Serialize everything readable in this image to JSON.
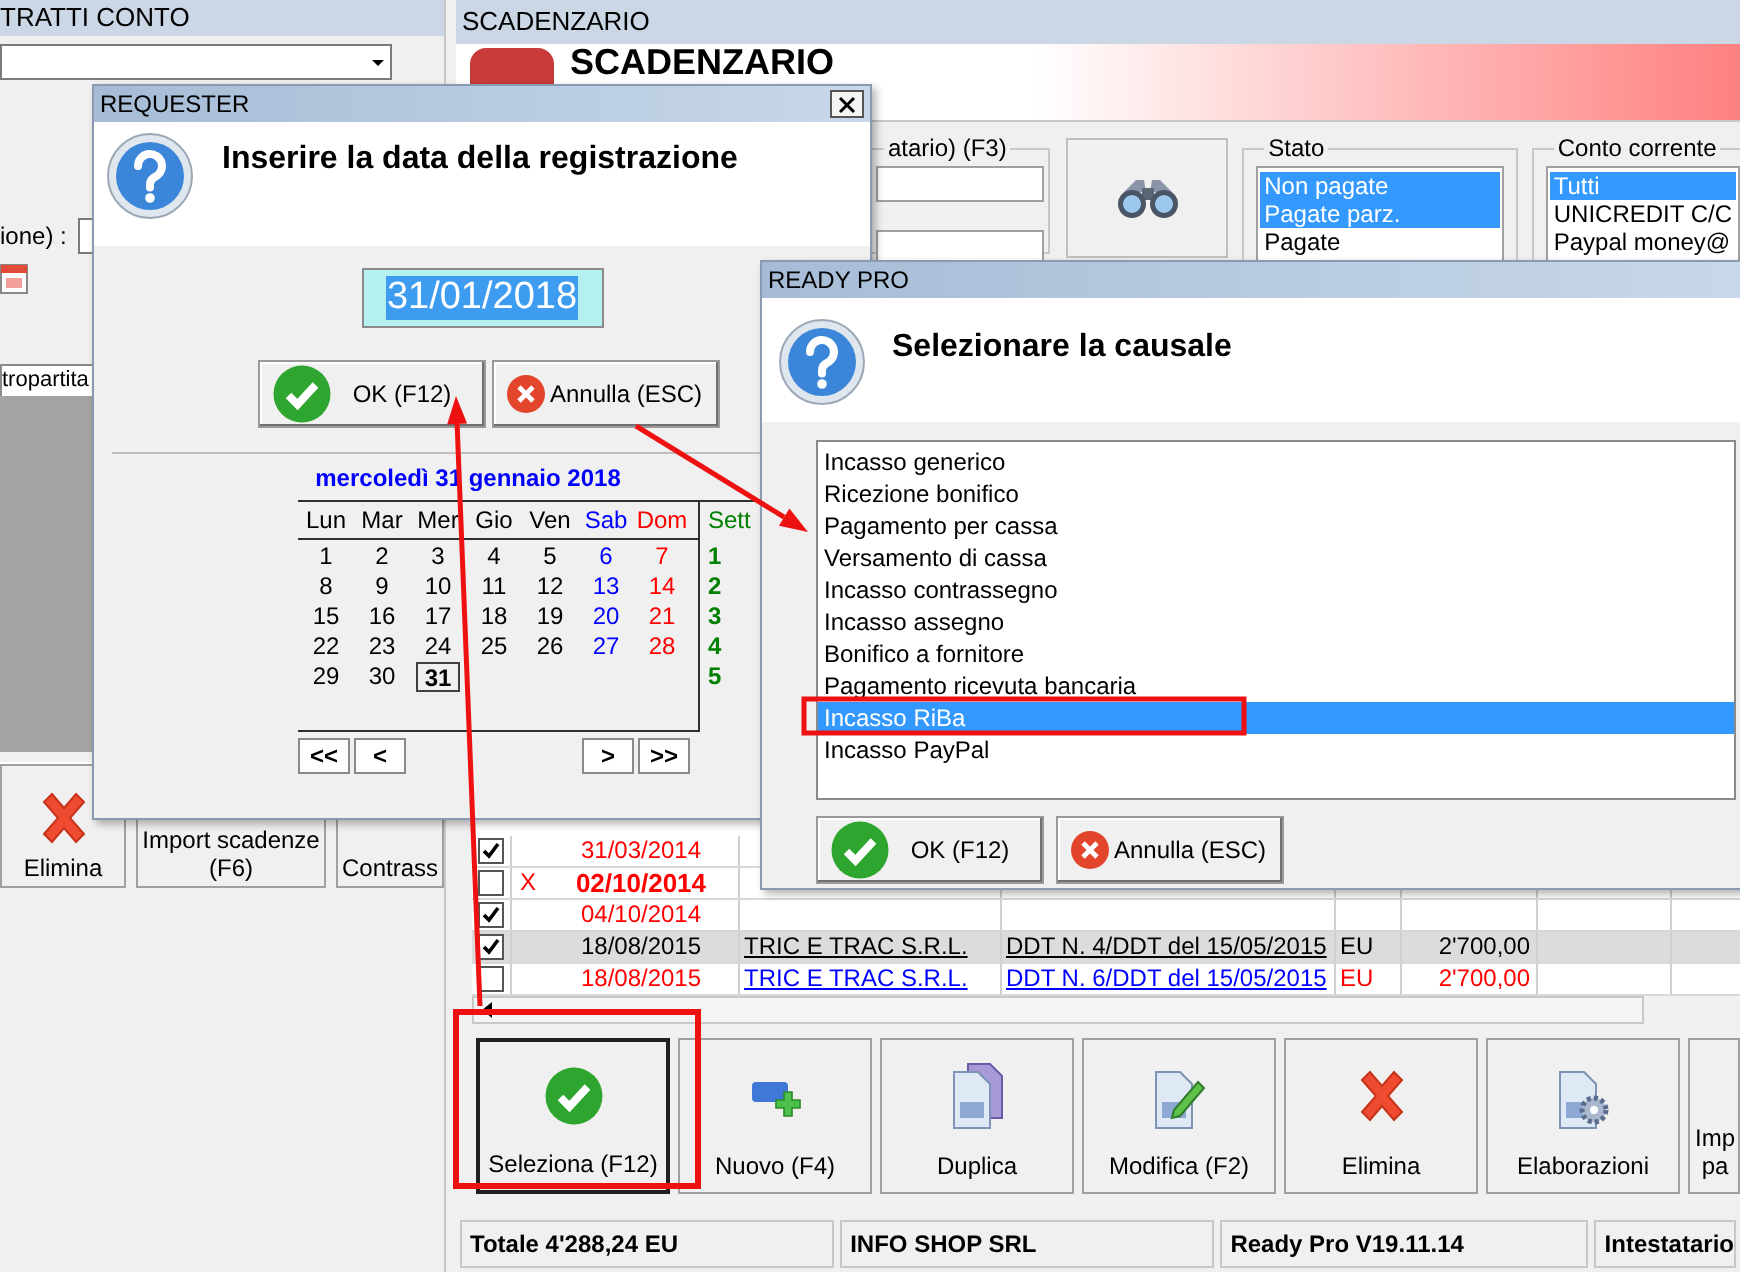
{
  "left_panel": {
    "title": "TRATTI CONTO",
    "field_label": "ione) :",
    "tab_label": "tropartita",
    "buttons": [
      {
        "label": "Elimina"
      },
      {
        "label": "Import scadenze (F6)"
      },
      {
        "label": "Contrass"
      }
    ]
  },
  "scadenzario": {
    "title": "SCADENZARIO",
    "heading": "SCADENZARIO",
    "search_legend": "atario) (F3)",
    "stato": {
      "legend": "Stato",
      "items": [
        {
          "label": "Non pagate",
          "selected": true
        },
        {
          "label": "Pagate parz.",
          "selected": true
        },
        {
          "label": "Pagate",
          "selected": false
        }
      ]
    },
    "conto_corrente": {
      "legend": "Conto corrente",
      "items": [
        {
          "label": "Tutti",
          "selected": true
        },
        {
          "label": "UNICREDIT C/C",
          "selected": false
        },
        {
          "label": "Paypal money@",
          "selected": false
        }
      ]
    },
    "table": {
      "rows": [
        {
          "checked": true,
          "selected": false,
          "overdue": true,
          "bold": false,
          "date": "31/03/2014"
        },
        {
          "checked": false,
          "selected": false,
          "overdue": true,
          "bold": true,
          "flag": "X",
          "date": "02/10/2014"
        },
        {
          "checked": true,
          "selected": false,
          "overdue": true,
          "bold": false,
          "date": "04/10/2014"
        },
        {
          "checked": true,
          "selected": true,
          "overdue": false,
          "bold": false,
          "date": "18/08/2015",
          "customer": "TRIC E TRAC S.R.L.",
          "document": "DDT N. 4/DDT del 15/05/2015",
          "currency": "EU",
          "amount": "2'700,00"
        },
        {
          "checked": false,
          "selected": false,
          "overdue": true,
          "bold": false,
          "date": "18/08/2015",
          "customer": "TRIC E TRAC S.R.L.",
          "document": "DDT N. 6/DDT del 15/05/2015",
          "currency": "EU",
          "amount": "2'700,00"
        }
      ]
    },
    "buttons": [
      {
        "label": "Seleziona (F12)",
        "focused": true
      },
      {
        "label": "Nuovo (F4)",
        "focused": false
      },
      {
        "label": "Duplica",
        "focused": false
      },
      {
        "label": "Modifica (F2)",
        "focused": false
      },
      {
        "label": "Elimina",
        "focused": false
      },
      {
        "label": "Elaborazioni",
        "focused": false
      },
      {
        "label": "Imp pa",
        "focused": false
      }
    ],
    "status_bar": [
      "Totale 4'288,24 EU",
      "INFO SHOP SRL",
      "Ready Pro V19.11.14",
      "Intestatario"
    ]
  },
  "requester": {
    "title": "REQUESTER",
    "message": "Inserire la data della registrazione",
    "date_value": "31/01/2018",
    "buttons": [
      {
        "label": "OK (F12)"
      },
      {
        "label": "Annulla (ESC)"
      }
    ],
    "calendar": {
      "caption": "mercoledì 31 gennaio 2018",
      "weekdays": [
        {
          "label": "Lun",
          "kind": "weekday"
        },
        {
          "label": "Mar",
          "kind": "weekday"
        },
        {
          "label": "Mer",
          "kind": "weekday"
        },
        {
          "label": "Gio",
          "kind": "weekday"
        },
        {
          "label": "Ven",
          "kind": "weekday"
        },
        {
          "label": "Sab",
          "kind": "saturday"
        },
        {
          "label": "Dom",
          "kind": "sunday"
        }
      ],
      "week_header": "Sett",
      "weeks": [
        {
          "number": "1",
          "days": [
            {
              "label": "1",
              "selected": false
            },
            {
              "label": "2",
              "selected": false
            },
            {
              "label": "3",
              "selected": false
            },
            {
              "label": "4",
              "selected": false
            },
            {
              "label": "5",
              "selected": false
            },
            {
              "label": "6",
              "selected": false
            },
            {
              "label": "7",
              "selected": false
            }
          ]
        },
        {
          "number": "2",
          "days": [
            {
              "label": "8",
              "selected": false
            },
            {
              "label": "9",
              "selected": false
            },
            {
              "label": "10",
              "selected": false
            },
            {
              "label": "11",
              "selected": false
            },
            {
              "label": "12",
              "selected": false
            },
            {
              "label": "13",
              "selected": false
            },
            {
              "label": "14",
              "selected": false
            }
          ]
        },
        {
          "number": "3",
          "days": [
            {
              "label": "15",
              "selected": false
            },
            {
              "label": "16",
              "selected": false
            },
            {
              "label": "17",
              "selected": false
            },
            {
              "label": "18",
              "selected": false
            },
            {
              "label": "19",
              "selected": false
            },
            {
              "label": "20",
              "selected": false
            },
            {
              "label": "21",
              "selected": false
            }
          ]
        },
        {
          "number": "4",
          "days": [
            {
              "label": "22",
              "selected": false
            },
            {
              "label": "23",
              "selected": false
            },
            {
              "label": "24",
              "selected": false
            },
            {
              "label": "25",
              "selected": false
            },
            {
              "label": "26",
              "selected": false
            },
            {
              "label": "27",
              "selected": false
            },
            {
              "label": "28",
              "selected": false
            }
          ]
        },
        {
          "number": "5",
          "days": [
            {
              "label": "29",
              "selected": false
            },
            {
              "label": "30",
              "selected": false
            },
            {
              "label": "31",
              "selected": true
            }
          ]
        }
      ],
      "nav": [
        "<<",
        "<",
        ">",
        ">>"
      ]
    }
  },
  "ready_pro": {
    "title": "READY PRO",
    "message": "Selezionare la causale",
    "items": [
      {
        "label": "Incasso generico",
        "selected": false
      },
      {
        "label": "Ricezione bonifico",
        "selected": false
      },
      {
        "label": "Pagamento per cassa",
        "selected": false
      },
      {
        "label": "Versamento di cassa",
        "selected": false
      },
      {
        "label": "Incasso contrassegno",
        "selected": false
      },
      {
        "label": "Incasso assegno",
        "selected": false
      },
      {
        "label": "Bonifico a fornitore",
        "selected": false
      },
      {
        "label": "Pagamento ricevuta bancaria",
        "selected": false
      },
      {
        "label": "Incasso RiBa",
        "selected": true
      },
      {
        "label": "Incasso PayPal",
        "selected": false
      }
    ],
    "buttons": [
      {
        "label": "OK (F12)"
      },
      {
        "label": "Annulla (ESC)"
      }
    ]
  }
}
